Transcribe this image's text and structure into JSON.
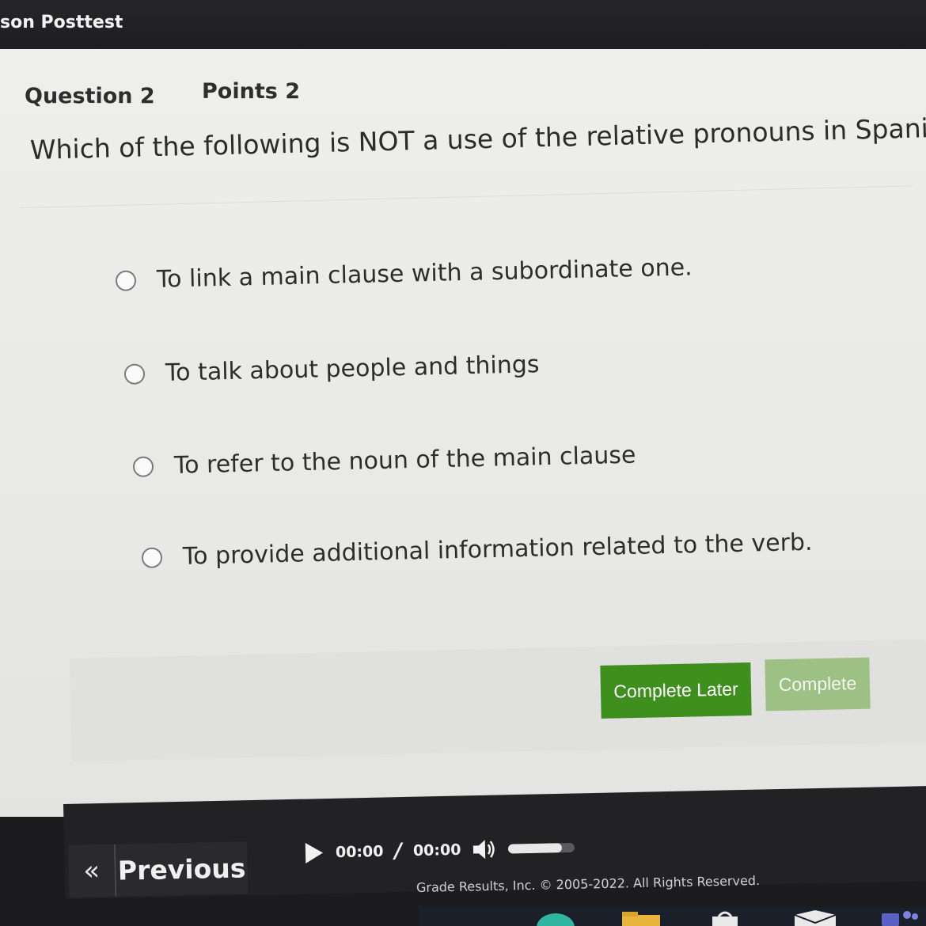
{
  "window": {
    "title": "son Posttest"
  },
  "question": {
    "number_label": "Question 2",
    "points_label": "Points 2",
    "text": "Which of the following is NOT a use of the relative pronouns in Spanish?"
  },
  "options": [
    {
      "label": "To link a main clause with a subordinate one.",
      "selected": false
    },
    {
      "label": "To talk about people and things",
      "selected": false
    },
    {
      "label": "To refer to the noun of the main clause",
      "selected": false
    },
    {
      "label": "To provide additional information related to the verb.",
      "selected": false
    }
  ],
  "actions": {
    "complete_later_label": "Complete Later",
    "complete_label": "Complete"
  },
  "navigation": {
    "prev_chevron": "«",
    "previous_label": "Previous"
  },
  "player": {
    "current_time": "00:00",
    "separator": "/",
    "total_time": "00:00",
    "volume_level": 0.8
  },
  "footer": {
    "copyright": "Grade Results, Inc. © 2005-2022. All Rights Reserved."
  },
  "colors": {
    "complete_later_bg": "#3f8f1f",
    "complete_bg": "#9dc084",
    "topbar_bg": "#262628",
    "panel_bg": "#eeeeec"
  },
  "icons": {
    "play": "play-icon",
    "volume": "volume-icon",
    "radio": "radio-unchecked-icon"
  }
}
